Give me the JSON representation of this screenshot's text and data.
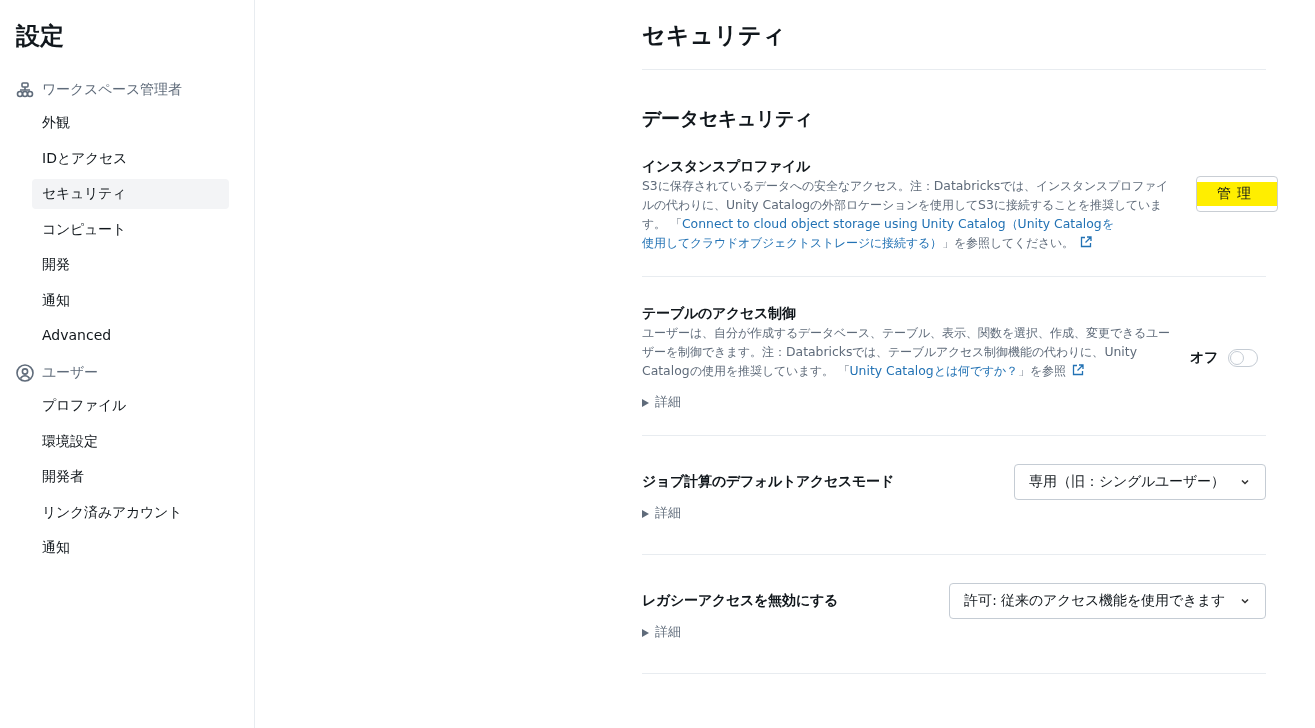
{
  "sidebar": {
    "title": "設定",
    "groups": [
      {
        "kind": "admin",
        "label": "ワークスペース管理者",
        "items": [
          {
            "label": "外観",
            "selected": false
          },
          {
            "label": "IDとアクセス",
            "selected": false
          },
          {
            "label": "セキュリティ",
            "selected": true
          },
          {
            "label": "コンピュート",
            "selected": false
          },
          {
            "label": "開発",
            "selected": false
          },
          {
            "label": "通知",
            "selected": false
          },
          {
            "label": "Advanced",
            "selected": false
          }
        ]
      },
      {
        "kind": "user",
        "label": "ユーザー",
        "items": [
          {
            "label": "プロファイル",
            "selected": false
          },
          {
            "label": "環境設定",
            "selected": false
          },
          {
            "label": "開発者",
            "selected": false
          },
          {
            "label": "リンク済みアカウント",
            "selected": false
          },
          {
            "label": "通知",
            "selected": false
          }
        ]
      }
    ]
  },
  "page": {
    "title": "セキュリティ",
    "section_title": "データセキュリティ",
    "settings": [
      {
        "kind": "button",
        "title": "インスタンスプロファイル",
        "description": "S3に保存されているデータへの安全なアクセス。注：Databricksでは、インスタンスプロファイルの代わりに、Unity Catalogの外部ロケーションを使用してS3に接続することを推奨しています。 「",
        "link": [
          "Connect to cloud object storage using Unity Catalog（Unity Catalogを",
          "使用してクラウドオブジェクトストレージに接続する）"
        ],
        "description_end": "」を参照してください。",
        "button": {
          "label": "管理",
          "highlighted": true
        }
      },
      {
        "kind": "toggle",
        "title": "テーブルのアクセス制御",
        "description": "ユーザーは、自分が作成するデータベース、テーブル、表示、関数を選択、作成、変更できるユーザーを制御できます。注：Databricksでは、テーブルアクセス制御機能の代わりに、Unity Catalogの使用を推奨しています。 「",
        "link": [
          "Unity Catalogとは何ですか？"
        ],
        "description_end": "」を参照",
        "toggle": {
          "label": "オフ",
          "on": false
        },
        "details": "詳細"
      },
      {
        "kind": "select",
        "title": "ジョブ計算のデフォルトアクセスモード",
        "select": {
          "value": "専用（旧：シングルユーザー）"
        },
        "details": "詳細"
      },
      {
        "kind": "select",
        "title": "レガシーアクセスを無効にする",
        "select": {
          "value": "許可: 従来のアクセス機能を使用できます"
        },
        "details": "詳細"
      }
    ]
  }
}
